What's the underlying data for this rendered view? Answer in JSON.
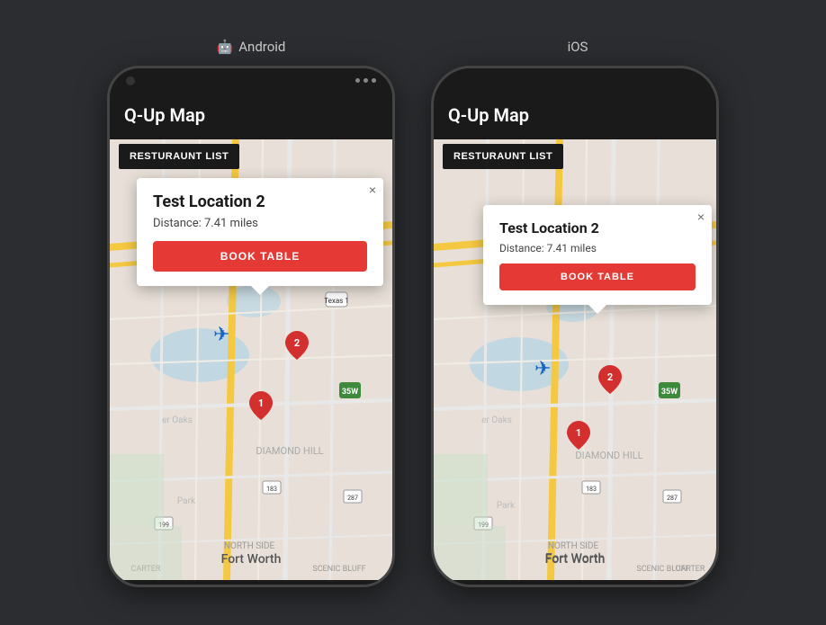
{
  "platforms": [
    {
      "id": "android",
      "label": "Android",
      "icon": "🤖"
    },
    {
      "id": "ios",
      "label": "iOS",
      "icon": ""
    }
  ],
  "app": {
    "title": "Q-Up Map",
    "restaurant_list_btn": "RESTURAUNT LIST",
    "popup": {
      "location_name": "Test Location 2",
      "distance_label": "Distance: 7.41 miles",
      "book_btn": "BOOK TABLE",
      "close_label": "×"
    },
    "city_label": "Fort Worth",
    "markers": [
      {
        "num": "1",
        "color": "#d32f2f"
      },
      {
        "num": "2",
        "color": "#d32f2f"
      }
    ]
  }
}
